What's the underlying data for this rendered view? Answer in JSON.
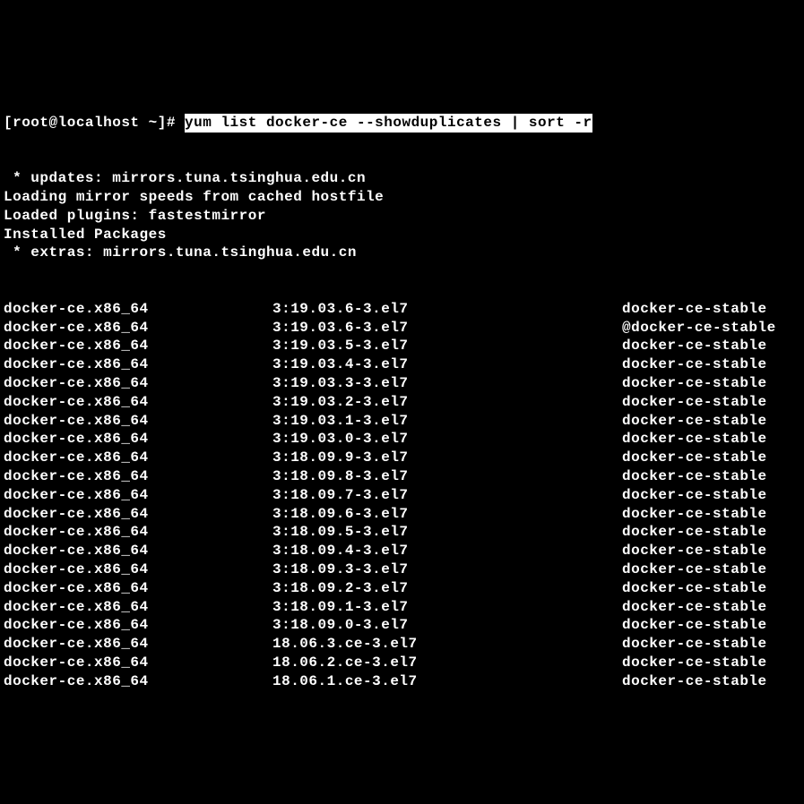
{
  "prompt": "[root@localhost ~]# ",
  "command": "yum list docker-ce --showduplicates | sort -r",
  "header_lines": [
    " * updates: mirrors.tuna.tsinghua.edu.cn",
    "Loading mirror speeds from cached hostfile",
    "Loaded plugins: fastestmirror",
    "Installed Packages",
    " * extras: mirrors.tuna.tsinghua.edu.cn"
  ],
  "packages": [
    {
      "name": "docker-ce.x86_64",
      "version": "3:19.03.6-3.el7",
      "repo": "docker-ce-stable"
    },
    {
      "name": "docker-ce.x86_64",
      "version": "3:19.03.6-3.el7",
      "repo": "@docker-ce-stable"
    },
    {
      "name": "docker-ce.x86_64",
      "version": "3:19.03.5-3.el7",
      "repo": "docker-ce-stable"
    },
    {
      "name": "docker-ce.x86_64",
      "version": "3:19.03.4-3.el7",
      "repo": "docker-ce-stable"
    },
    {
      "name": "docker-ce.x86_64",
      "version": "3:19.03.3-3.el7",
      "repo": "docker-ce-stable"
    },
    {
      "name": "docker-ce.x86_64",
      "version": "3:19.03.2-3.el7",
      "repo": "docker-ce-stable"
    },
    {
      "name": "docker-ce.x86_64",
      "version": "3:19.03.1-3.el7",
      "repo": "docker-ce-stable"
    },
    {
      "name": "docker-ce.x86_64",
      "version": "3:19.03.0-3.el7",
      "repo": "docker-ce-stable"
    },
    {
      "name": "docker-ce.x86_64",
      "version": "3:18.09.9-3.el7",
      "repo": "docker-ce-stable"
    },
    {
      "name": "docker-ce.x86_64",
      "version": "3:18.09.8-3.el7",
      "repo": "docker-ce-stable"
    },
    {
      "name": "docker-ce.x86_64",
      "version": "3:18.09.7-3.el7",
      "repo": "docker-ce-stable"
    },
    {
      "name": "docker-ce.x86_64",
      "version": "3:18.09.6-3.el7",
      "repo": "docker-ce-stable"
    },
    {
      "name": "docker-ce.x86_64",
      "version": "3:18.09.5-3.el7",
      "repo": "docker-ce-stable"
    },
    {
      "name": "docker-ce.x86_64",
      "version": "3:18.09.4-3.el7",
      "repo": "docker-ce-stable"
    },
    {
      "name": "docker-ce.x86_64",
      "version": "3:18.09.3-3.el7",
      "repo": "docker-ce-stable"
    },
    {
      "name": "docker-ce.x86_64",
      "version": "3:18.09.2-3.el7",
      "repo": "docker-ce-stable"
    },
    {
      "name": "docker-ce.x86_64",
      "version": "3:18.09.1-3.el7",
      "repo": "docker-ce-stable"
    },
    {
      "name": "docker-ce.x86_64",
      "version": "3:18.09.0-3.el7",
      "repo": "docker-ce-stable"
    },
    {
      "name": "docker-ce.x86_64",
      "version": "18.06.3.ce-3.el7",
      "repo": "docker-ce-stable"
    },
    {
      "name": "docker-ce.x86_64",
      "version": "18.06.2.ce-3.el7",
      "repo": "docker-ce-stable"
    },
    {
      "name": "docker-ce.x86_64",
      "version": "18.06.1.ce-3.el7",
      "repo": "docker-ce-stable"
    }
  ]
}
